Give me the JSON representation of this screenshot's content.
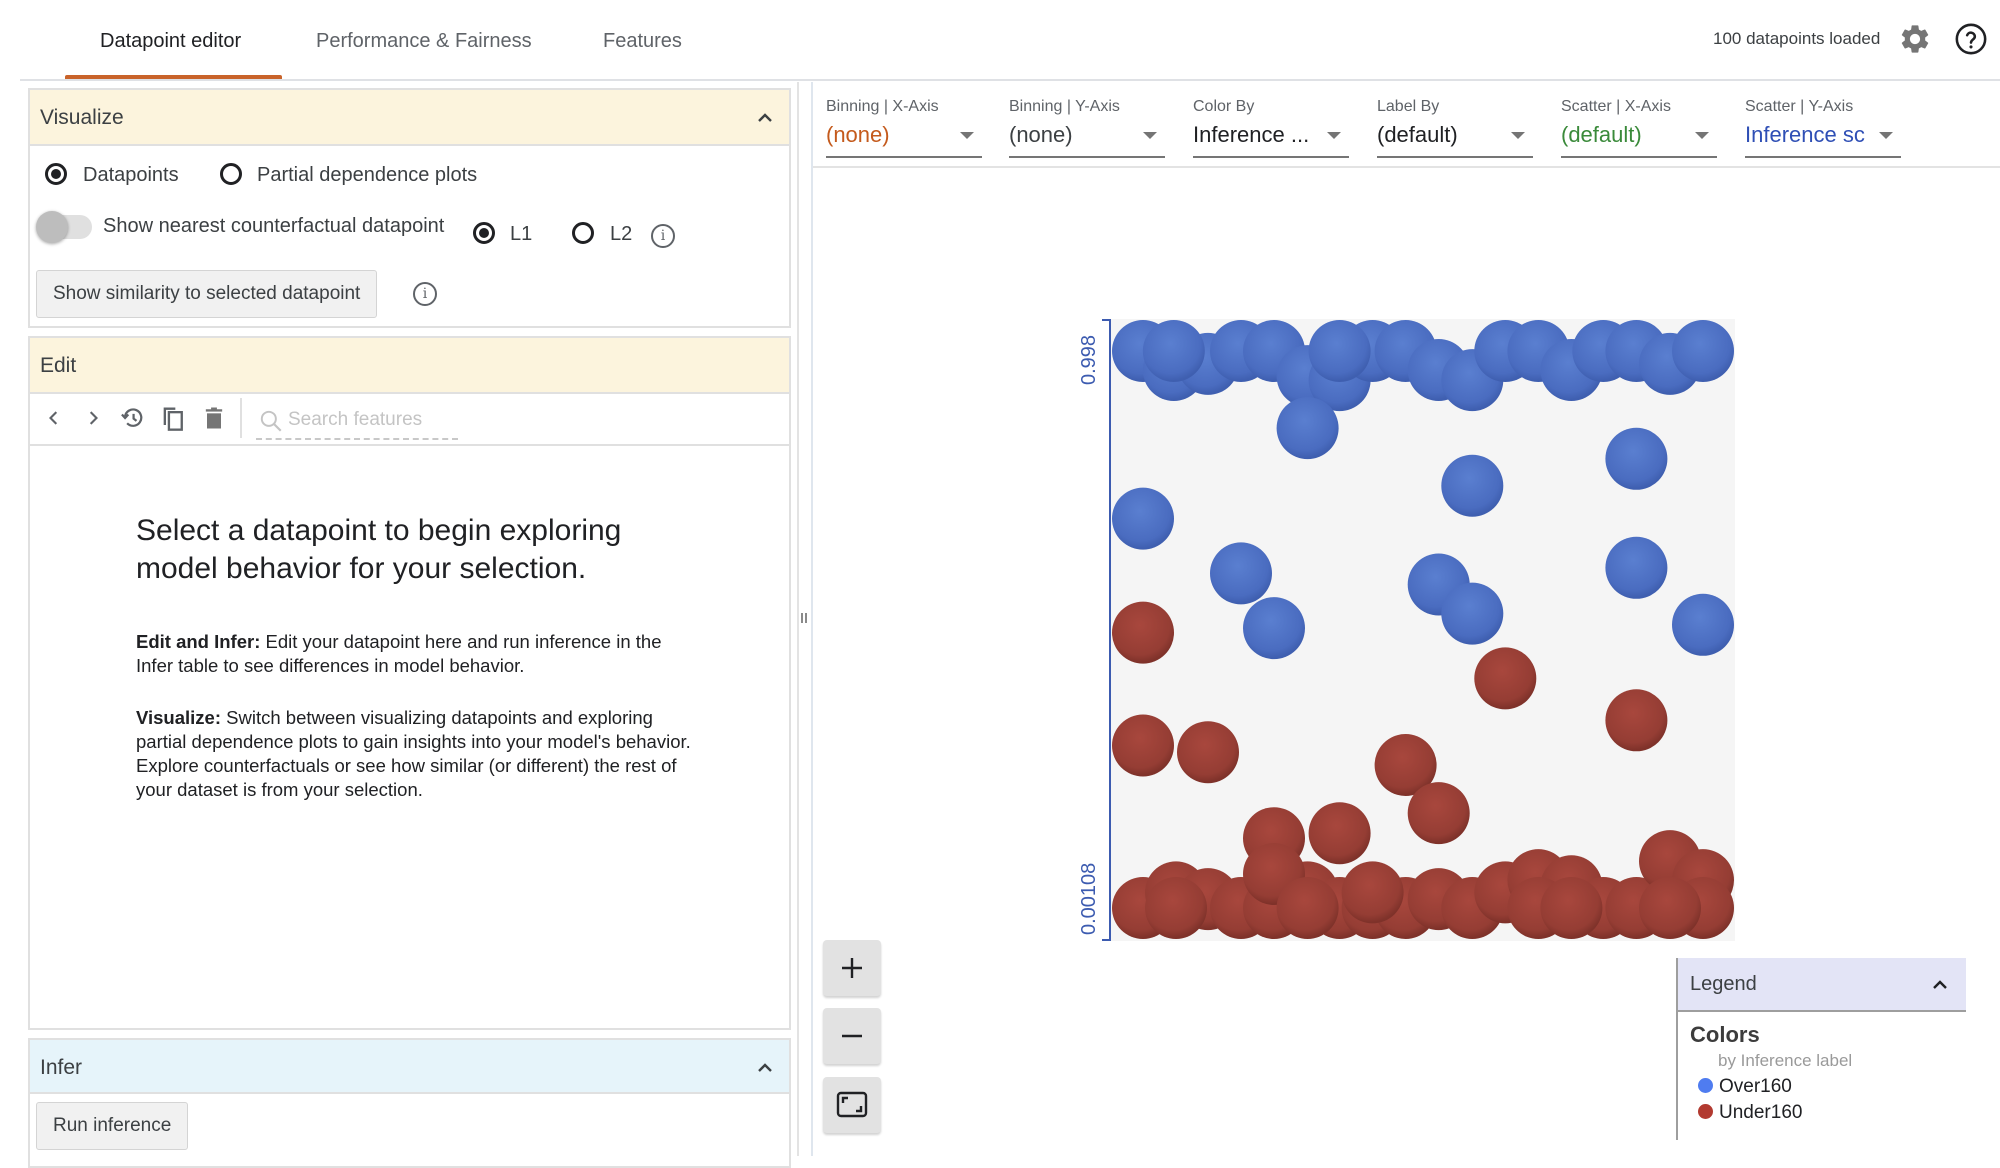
{
  "tabs": [
    {
      "label": "Datapoint editor",
      "active": true
    },
    {
      "label": "Performance & Fairness",
      "active": false
    },
    {
      "label": "Features",
      "active": false
    }
  ],
  "header": {
    "status": "100 datapoints loaded",
    "settings_icon": "gear-icon",
    "help_icon": "help-circle-icon"
  },
  "visualize": {
    "title": "Visualize",
    "mode_options": [
      {
        "label": "Datapoints",
        "selected": true
      },
      {
        "label": "Partial dependence plots",
        "selected": false
      }
    ],
    "counterfactual_toggle_label": "Show nearest counterfactual datapoint",
    "counterfactual_enabled": false,
    "distance_options": [
      {
        "label": "L1",
        "selected": true
      },
      {
        "label": "L2",
        "selected": false
      }
    ],
    "similarity_button": "Show similarity to selected datapoint"
  },
  "edit": {
    "title": "Edit",
    "search_placeholder": "Search features",
    "search_value": "",
    "empty_title": "Select a datapoint to begin exploring model behavior for your selection.",
    "para1_bold": "Edit and Infer:",
    "para1_text": " Edit your datapoint here and run inference in the Infer table to see differences in model behavior.",
    "para2_bold": "Visualize:",
    "para2_text": " Switch between visualizing datapoints and exploring partial dependence plots to gain insights into your model's behavior. Explore counterfactuals or see how similar (or different) the rest of your dataset is from your selection."
  },
  "infer": {
    "title": "Infer",
    "run_button": "Run inference"
  },
  "controls": [
    {
      "label": "Binning | X-Axis",
      "value": "(none)",
      "color": "#c45a1c"
    },
    {
      "label": "Binning | Y-Axis",
      "value": "(none)",
      "color": "#3c4043"
    },
    {
      "label": "Color By",
      "value": "Inference ...",
      "color": "#202124"
    },
    {
      "label": "Label By",
      "value": "(default)",
      "color": "#202124"
    },
    {
      "label": "Scatter | X-Axis",
      "value": "(default)",
      "color": "#3a8a3a"
    },
    {
      "label": "Scatter | Y-Axis",
      "value": "Inference sc",
      "color": "#2f4fb5"
    }
  ],
  "legend": {
    "title": "Legend",
    "section": "Colors",
    "subtitle": "by Inference label",
    "items": [
      {
        "label": "Over160",
        "color": "#4f7cf0"
      },
      {
        "label": "Under160",
        "color": "#b23a30"
      }
    ]
  },
  "chart_data": {
    "type": "scatter",
    "title": "",
    "xlabel": "(default)",
    "ylabel": "Inference score",
    "y_tick_labels": [
      "0.998",
      "0.00108"
    ],
    "ylim": [
      0.00108,
      0.998
    ],
    "xlim": [
      0,
      1
    ],
    "color_by": "Inference label",
    "series": [
      {
        "name": "Over160",
        "color": "#4a6fc4",
        "points": [
          {
            "x": 0.0,
            "y": 0.998
          },
          {
            "x": 0.055,
            "y": 0.964
          },
          {
            "x": 0.116,
            "y": 0.975
          },
          {
            "x": 0.175,
            "y": 0.998
          },
          {
            "x": 0.234,
            "y": 0.998
          },
          {
            "x": 0.294,
            "y": 0.953
          },
          {
            "x": 0.351,
            "y": 0.946
          },
          {
            "x": 0.41,
            "y": 0.998
          },
          {
            "x": 0.469,
            "y": 0.998
          },
          {
            "x": 0.528,
            "y": 0.964
          },
          {
            "x": 0.588,
            "y": 0.946
          },
          {
            "x": 0.647,
            "y": 0.998
          },
          {
            "x": 0.706,
            "y": 0.998
          },
          {
            "x": 0.765,
            "y": 0.964
          },
          {
            "x": 0.822,
            "y": 0.998
          },
          {
            "x": 0.881,
            "y": 0.998
          },
          {
            "x": 0.941,
            "y": 0.975
          },
          {
            "x": 1.0,
            "y": 0.998
          },
          {
            "x": 0.055,
            "y": 0.998
          },
          {
            "x": 0.351,
            "y": 0.998
          },
          {
            "x": 0.294,
            "y": 0.86
          },
          {
            "x": 0.0,
            "y": 0.698
          },
          {
            "x": 0.588,
            "y": 0.757
          },
          {
            "x": 0.881,
            "y": 0.805
          },
          {
            "x": 0.175,
            "y": 0.6
          },
          {
            "x": 0.234,
            "y": 0.502
          },
          {
            "x": 0.528,
            "y": 0.58
          },
          {
            "x": 0.588,
            "y": 0.528
          },
          {
            "x": 0.881,
            "y": 0.61
          },
          {
            "x": 1.0,
            "y": 0.508
          }
        ]
      },
      {
        "name": "Under160",
        "color": "#a13e35",
        "points": [
          {
            "x": 0.0,
            "y": 0.494
          },
          {
            "x": 0.647,
            "y": 0.412
          },
          {
            "x": 0.881,
            "y": 0.337
          },
          {
            "x": 0.0,
            "y": 0.292
          },
          {
            "x": 0.116,
            "y": 0.28
          },
          {
            "x": 0.469,
            "y": 0.257
          },
          {
            "x": 0.528,
            "y": 0.171
          },
          {
            "x": 0.234,
            "y": 0.126
          },
          {
            "x": 0.351,
            "y": 0.135
          },
          {
            "x": 0.0,
            "y": 0.001
          },
          {
            "x": 0.059,
            "y": 0.029
          },
          {
            "x": 0.116,
            "y": 0.017
          },
          {
            "x": 0.175,
            "y": 0.001
          },
          {
            "x": 0.234,
            "y": 0.001
          },
          {
            "x": 0.294,
            "y": 0.029
          },
          {
            "x": 0.351,
            "y": 0.001
          },
          {
            "x": 0.41,
            "y": 0.001
          },
          {
            "x": 0.469,
            "y": 0.001
          },
          {
            "x": 0.528,
            "y": 0.017
          },
          {
            "x": 0.588,
            "y": 0.001
          },
          {
            "x": 0.647,
            "y": 0.029
          },
          {
            "x": 0.706,
            "y": 0.051
          },
          {
            "x": 0.765,
            "y": 0.04
          },
          {
            "x": 0.822,
            "y": 0.001
          },
          {
            "x": 0.881,
            "y": 0.001
          },
          {
            "x": 0.941,
            "y": 0.085
          },
          {
            "x": 1.0,
            "y": 0.051
          },
          {
            "x": 1.0,
            "y": 0.001
          },
          {
            "x": 0.234,
            "y": 0.062
          },
          {
            "x": 0.059,
            "y": 0.001
          },
          {
            "x": 0.294,
            "y": 0.001
          },
          {
            "x": 0.706,
            "y": 0.001
          },
          {
            "x": 0.941,
            "y": 0.001
          },
          {
            "x": 0.765,
            "y": 0.001
          },
          {
            "x": 0.41,
            "y": 0.029
          }
        ]
      }
    ]
  }
}
